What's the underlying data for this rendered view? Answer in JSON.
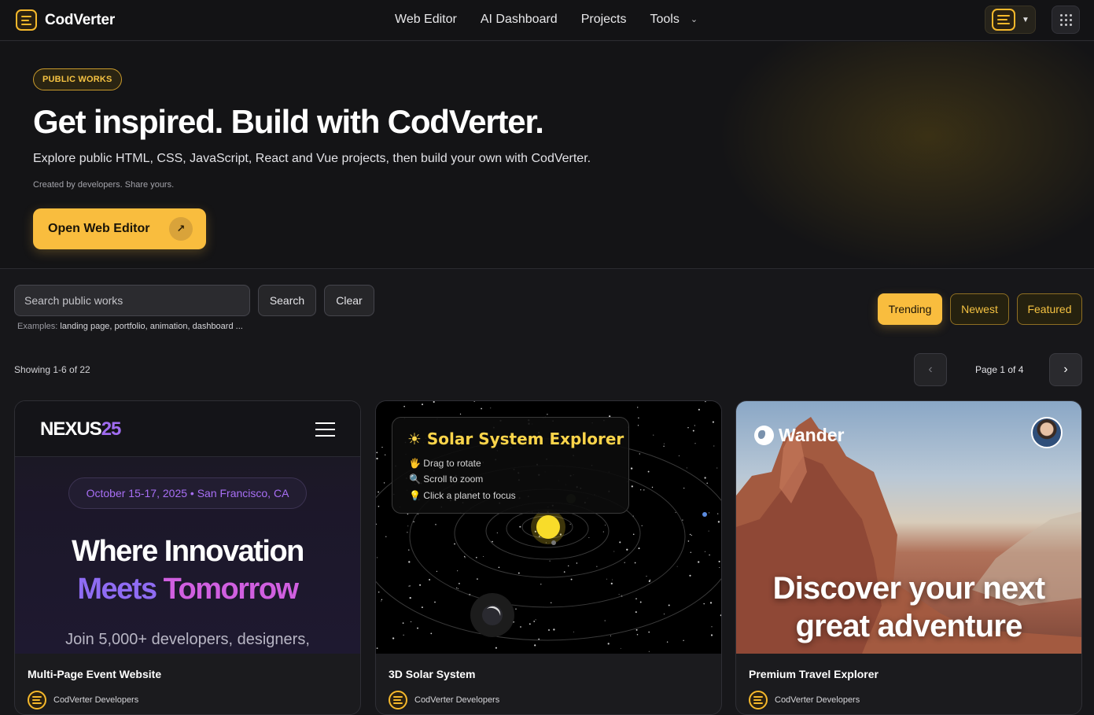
{
  "app": {
    "name": "CodVerter"
  },
  "nav": {
    "items": [
      "Web Editor",
      "AI Dashboard",
      "Projects",
      "Tools"
    ]
  },
  "hero": {
    "badge": "PUBLIC WORKS",
    "title": "Get inspired. Build with CodVerter.",
    "subtitle": "Explore public HTML, CSS, JavaScript, React and Vue projects, then build your own with CodVerter.",
    "note": "Created by developers. Share yours.",
    "cta_label": "Open Web Editor",
    "cta_icon": "arrow-up-right-icon"
  },
  "search": {
    "placeholder": "Search public works",
    "search_label": "Search",
    "clear_label": "Clear",
    "examples_prefix": "Examples:",
    "examples": "landing page, portfolio, animation, dashboard ..."
  },
  "filters": {
    "trending": "Trending",
    "newest": "Newest",
    "featured": "Featured",
    "active": "Trending"
  },
  "results": {
    "showing": "Showing 1-6 of 22",
    "page_info": "Page 1 of 4",
    "prev": "‹",
    "next": "›"
  },
  "colors": {
    "accent": "#f9bd3e",
    "background": "#17171a",
    "purple": "#a06cf0"
  },
  "cards": [
    {
      "title": "Multi-Page Event Website",
      "author": "CodVerter Developers",
      "preview": {
        "brand_a": "NEXUS",
        "brand_b": "25",
        "date": "October 15-17, 2025 • San Francisco, CA",
        "headline_1": "Where Innovation",
        "headline_2a": "Meets ",
        "headline_2b": "Tomorrow",
        "body": "Join 5,000+ developers, designers,"
      }
    },
    {
      "title": "3D Solar System",
      "author": "CodVerter Developers",
      "preview": {
        "heading": "☀ Solar System Explorer",
        "hints": [
          "🖐 Drag to rotate",
          "🔍 Scroll to zoom",
          "💡 Click a planet to focus"
        ]
      }
    },
    {
      "title": "Premium Travel Explorer",
      "author": "CodVerter Developers",
      "preview": {
        "brand": "Wander",
        "headline_1": "Discover your next",
        "headline_2": "great adventure"
      }
    }
  ]
}
